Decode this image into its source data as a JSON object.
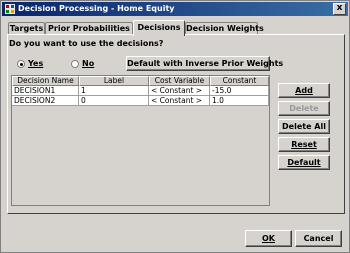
{
  "window": {
    "title": "Decision Processing - Home Equity",
    "close_label": "x"
  },
  "tabs": [
    {
      "label": "Targets",
      "active": false
    },
    {
      "label": "Prior Probabilities",
      "active": false
    },
    {
      "label": "Decisions",
      "active": true
    },
    {
      "label": "Decision Weights",
      "active": false
    }
  ],
  "decisions": {
    "question": "Do you want to use the decisions?",
    "radio_yes": "Yes",
    "radio_no": "No",
    "selected": "Yes",
    "default_inverse_button": "Default with Inverse Prior Weights"
  },
  "table": {
    "columns": [
      "Decision Name",
      "Label",
      "Cost Variable",
      "Constant"
    ],
    "rows": [
      [
        "DECISION1",
        "1",
        "< Constant >",
        "-15.0"
      ],
      [
        "DECISION2",
        "0",
        "< Constant >",
        "1.0"
      ]
    ]
  },
  "side_buttons": {
    "add": "Add",
    "delete": "Delete",
    "delete_all": "Delete All",
    "reset": "Reset",
    "default": "Default"
  },
  "dialog_buttons": {
    "ok": "OK",
    "cancel": "Cancel"
  },
  "colors": {
    "titlebar_start": "#0a246a",
    "titlebar_end": "#3a6ea5",
    "face": "#d6d3ce"
  }
}
